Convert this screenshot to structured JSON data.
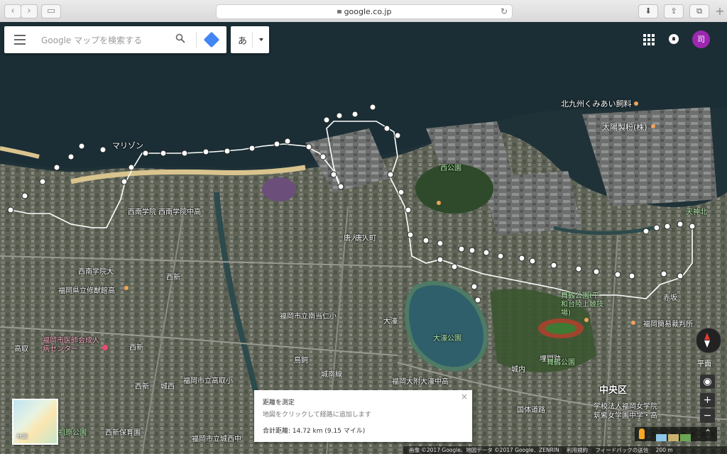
{
  "browser": {
    "url": "google.co.jp",
    "back_icon": "chevron-left-icon",
    "forward_icon": "chevron-right-icon",
    "sidebar_icon": "sidebar-icon",
    "download_icon": "download-icon",
    "share_icon": "share-icon",
    "tabs_icon": "tabs-icon",
    "new_tab": "+"
  },
  "search": {
    "placeholder": "Google マップを検索する",
    "ime_char": "あ"
  },
  "user": {
    "avatar_initial": "司"
  },
  "map_labels": [
    {
      "text": "北九州くみあい飼料",
      "cls": "big"
    },
    {
      "text": "太陽製粉(株)",
      "cls": "big"
    },
    {
      "text": "マリゾン",
      "cls": "big"
    },
    {
      "text": "西公園",
      "cls": "green"
    },
    {
      "text": "西南学院 西南学院中高",
      "cls": ""
    },
    {
      "text": "西南学院大",
      "cls": ""
    },
    {
      "text": "福岡県立修猷館高",
      "cls": ""
    },
    {
      "text": "西新",
      "cls": ""
    },
    {
      "text": "福岡市立南当仁小",
      "cls": ""
    },
    {
      "text": "大濠",
      "cls": ""
    },
    {
      "text": "福岡市医師会成人病センター",
      "cls": "pink"
    },
    {
      "text": "高取",
      "cls": ""
    },
    {
      "text": "西新",
      "cls": ""
    },
    {
      "text": "唐人町",
      "cls": ""
    },
    {
      "text": "鳥飼",
      "cls": ""
    },
    {
      "text": "城南線",
      "cls": ""
    },
    {
      "text": "福岡市立高取小",
      "cls": ""
    },
    {
      "text": "城西",
      "cls": ""
    },
    {
      "text": "大濠公園",
      "cls": "green"
    },
    {
      "text": "福岡大附大濠中高",
      "cls": ""
    },
    {
      "text": "舞鶴公園(平和台陸上競技場)",
      "cls": "green"
    },
    {
      "text": "埋門跡",
      "cls": ""
    },
    {
      "text": "舞鶴公園",
      "cls": "green"
    },
    {
      "text": "城内",
      "cls": ""
    },
    {
      "text": "福岡簡易裁判所",
      "cls": ""
    },
    {
      "text": "天神北",
      "cls": "green"
    },
    {
      "text": "赤坂",
      "cls": ""
    },
    {
      "text": "中央区",
      "cls": "dark"
    },
    {
      "text": "学校法人福岡女学院",
      "cls": ""
    },
    {
      "text": "筑紫女学園中学・高",
      "cls": ""
    },
    {
      "text": "国体道路",
      "cls": ""
    },
    {
      "text": "福岡市立城西中",
      "cls": ""
    },
    {
      "text": "西新保育園",
      "cls": ""
    },
    {
      "text": "祖原公園",
      "cls": "green"
    },
    {
      "text": "西新",
      "cls": ""
    },
    {
      "text": "唐人町",
      "cls": ""
    }
  ],
  "measure": {
    "title": "距離を測定",
    "hint": "地図をクリックして経路に追加します",
    "total": "合計距離: 14.72 km (9.15 マイル)",
    "close": "×"
  },
  "thumbnail": {
    "label": "地図"
  },
  "controls": {
    "flat_label": "平面",
    "zoom_in": "+",
    "zoom_out": "−"
  },
  "footer": {
    "imagery": "画像 ©2017 Google、地図データ ©2017 Google、ZENRIN",
    "terms": "利用規約",
    "feedback": "フィードバックの送信",
    "scale": "200 m"
  }
}
